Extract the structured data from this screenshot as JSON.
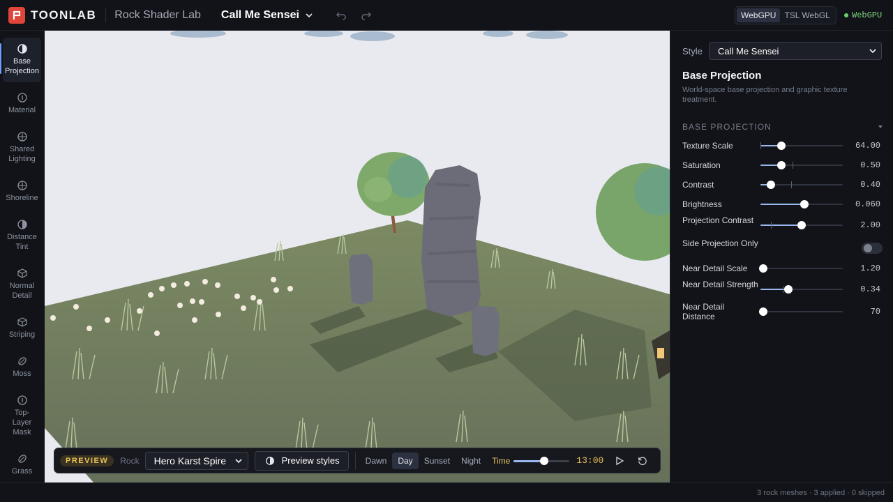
{
  "header": {
    "brand": "TOONLAB",
    "app_title": "Rock Shader Lab",
    "preset": "Call Me Sensei",
    "backends": [
      "WebGPU",
      "TSL WebGL"
    ],
    "active_backend": "WebGPU",
    "status": "WebGPU",
    "status_color": "#6fd06a"
  },
  "sidebar": {
    "items": [
      {
        "label": "Base Projection",
        "icon": "half-circle-icon",
        "active": true
      },
      {
        "label": "Material",
        "icon": "info-circle-icon",
        "active": false
      },
      {
        "label": "Shared Lighting",
        "icon": "crosshair-icon",
        "active": false
      },
      {
        "label": "Shoreline",
        "icon": "crosshair-icon",
        "active": false
      },
      {
        "label": "Distance Tint",
        "icon": "half-circle-icon",
        "active": false
      },
      {
        "label": "Normal Detail",
        "icon": "cube-icon",
        "active": false
      },
      {
        "label": "Striping",
        "icon": "cube-icon",
        "active": false
      },
      {
        "label": "Moss",
        "icon": "leaf-icon",
        "active": false
      },
      {
        "label": "Top-Layer Mask",
        "icon": "info-circle-icon",
        "active": false
      },
      {
        "label": "Grass",
        "icon": "leaf-icon",
        "active": false
      }
    ]
  },
  "toolbar": {
    "preview_badge": "PREVIEW",
    "rock_label": "Rock",
    "rock_value": "Hero Karst Spire",
    "preview_styles_label": "Preview styles",
    "time_of_day": [
      "Dawn",
      "Day",
      "Sunset",
      "Night"
    ],
    "active_time_of_day": "Day",
    "time_label": "Time",
    "time_value": "13:00",
    "time_fraction": 0.55
  },
  "panel": {
    "style_label": "Style",
    "style_value": "Call Me Sensei",
    "section_title": "Base Projection",
    "section_desc": "World-space base projection and graphic texture treatment.",
    "group_title": "BASE PROJECTION",
    "params": [
      {
        "label": "Texture Scale",
        "value": "64.00",
        "fraction": 0.25,
        "mark": 0.0
      },
      {
        "label": "Saturation",
        "value": "0.50",
        "fraction": 0.25,
        "mark": 0.39
      },
      {
        "label": "Contrast",
        "value": "0.40",
        "fraction": 0.13,
        "mark": 0.37
      },
      {
        "label": "Brightness",
        "value": "0.060",
        "fraction": 0.53,
        "mark": null
      },
      {
        "label": "Projection Contrast",
        "value": "2.00",
        "fraction": 0.5,
        "mark": 0.13
      },
      {
        "label": "Side Projection Only",
        "toggle": true,
        "on": false
      },
      {
        "label": "Near Detail Scale",
        "value": "1.20",
        "fraction": 0.03,
        "mark": null
      },
      {
        "label": "Near Detail Strength",
        "value": "0.34",
        "fraction": 0.34,
        "mark": 0.27
      },
      {
        "label": "Near Detail Distance",
        "value": "70",
        "fraction": 0.03,
        "mark": null
      }
    ]
  },
  "statusbar": {
    "text": "3 rock meshes · 3 applied · 0 skipped"
  },
  "colors": {
    "accent": "#9ab8f0",
    "preview_badge": "#e8c15a",
    "brand": "#e0453a",
    "ground": "#6f7b5a",
    "sky": "#e9eaef",
    "rock": "#6b6c78"
  }
}
